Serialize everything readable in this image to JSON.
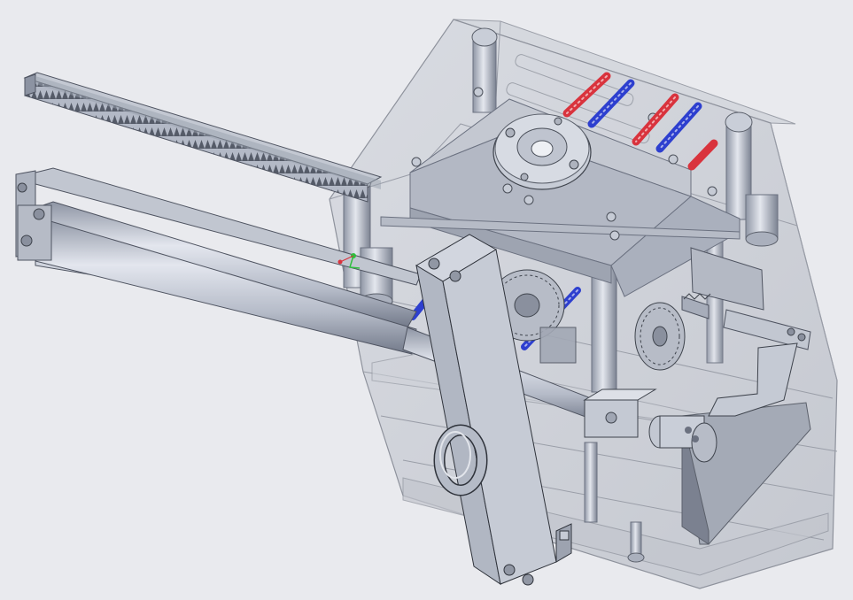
{
  "viewport": {
    "title": "",
    "background": "#e9eaee"
  },
  "colors": {
    "steel": "#a9afbd",
    "steel_dark": "#6b7180",
    "steel_light": "#d3d7e0",
    "mold_glass": "#c9ccd3",
    "mold_edge": "#8e929c",
    "hot_line": "#d9333d",
    "cold_line": "#2d3fcf",
    "outline": "#2a2c33"
  },
  "icons": {
    "orientation_triad": "axis-triad-icon",
    "lifting_eye": "eye-bolt-icon"
  },
  "parts": [
    "mold-base",
    "rack-bar",
    "hydraulic-cylinder",
    "lifting-plate",
    "locating-ring",
    "eye-bolt",
    "cooling-lines",
    "core-pull-gear",
    "guide-pillars",
    "latch-lock"
  ]
}
